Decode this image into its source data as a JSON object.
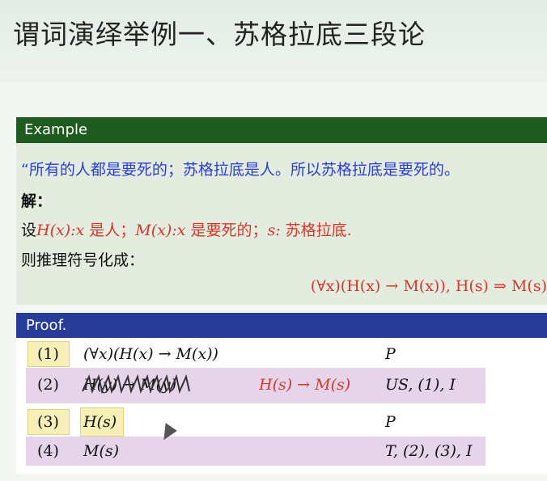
{
  "slide": {
    "title": "谓词演绎举例一、苏格拉底三段论"
  },
  "example": {
    "header": "Example",
    "quote": "“所有的人都是要死的；苏格拉底是人。所以苏格拉底是要死的。",
    "jie": "解：",
    "define_prefix": "设",
    "H_def": "H(x):x",
    "H_is": " 是人；",
    "M_def": "M(x):x",
    "M_is": " 是要死的；",
    "s_def": "s:",
    "s_is": " 苏格拉底.",
    "rule_text": "则推理符号化成：",
    "formula": "(∀x)(H(x) → M(x)), H(s) ⇒ M(s)"
  },
  "proof": {
    "header": "Proof.",
    "rows": [
      {
        "num": "(1)",
        "formula": "(∀x)(H(x) → M(x))",
        "note": "",
        "reason": "P"
      },
      {
        "num": "(2)",
        "formula": "H(y) → M(y)",
        "note": "H(s) → M(s)",
        "reason": "US, (1), I"
      },
      {
        "num": "(3)",
        "formula": "H(s)",
        "note": "",
        "reason": "P"
      },
      {
        "num": "(4)",
        "formula": "M(s)",
        "note": "",
        "reason": "T, (2), (3), I"
      }
    ]
  },
  "colors": {
    "example_header": "#1f5b1f",
    "proof_header": "#283d99",
    "quote_blue": "#2a3fd1",
    "math_red": "#d2382b",
    "row_violet": "#e6d4ea",
    "highlight_yellow": "#f6f0b8"
  }
}
